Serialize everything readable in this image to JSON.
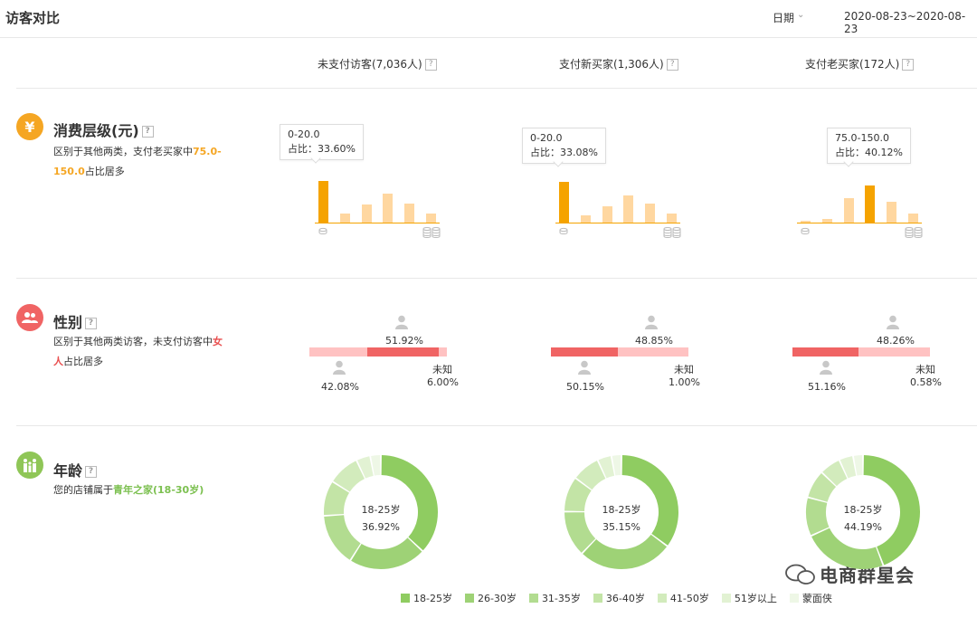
{
  "header": {
    "title": "访客对比",
    "date_label": "日期",
    "date_range": "2020-08-23~2020-08-23"
  },
  "columns": [
    {
      "label": "未支付访客(7,036人)"
    },
    {
      "label": "支付新买家(1,306人)"
    },
    {
      "label": "支付老买家(172人)"
    }
  ],
  "help_glyph": "?",
  "sections": {
    "consumption": {
      "title": "消费层级(元)",
      "desc_prefix": "区别于其他两类，支付老买家中",
      "desc_highlight": "75.0-150.0",
      "desc_suffix": "占比居多",
      "icon": "yen-icon",
      "icon_glyph": "¥",
      "color": "#f5a623"
    },
    "gender": {
      "title": "性别",
      "desc_prefix": "区别于其他两类访客，未支付访客中",
      "desc_highlight": "女人",
      "desc_suffix": "占比居多",
      "icon": "users-icon",
      "color": "#f06464"
    },
    "age": {
      "title": "年龄",
      "desc_prefix": "您的店铺属于",
      "desc_highlight": "青年之家(18-30岁)",
      "desc_suffix": "",
      "icon": "family-icon",
      "color": "#8fc657"
    }
  },
  "consumption_charts": [
    {
      "tooltip_range": "0-20.0",
      "tooltip_share": "占比：33.60%",
      "values": [
        33.6,
        7,
        14.5,
        23,
        15,
        7
      ],
      "highlight_index": 0
    },
    {
      "tooltip_range": "0-20.0",
      "tooltip_share": "占比：33.08%",
      "values": [
        33.08,
        6,
        13,
        22,
        15,
        7.5
      ],
      "highlight_index": 0
    },
    {
      "tooltip_range": "75.0-150.0",
      "tooltip_share": "占比：40.12%",
      "values": [
        1.5,
        3,
        19.5,
        30,
        16.5,
        7.5
      ],
      "highlight_index": 3
    }
  ],
  "gender_charts": [
    {
      "female": "51.92%",
      "male": "42.08%",
      "unknown_label": "未知",
      "unknown": "6.00%",
      "female_val": 51.92,
      "male_val": 42.08,
      "unknown_val": 6.0
    },
    {
      "female": "48.85%",
      "male": "50.15%",
      "unknown_label": "未知",
      "unknown": "1.00%",
      "female_val": 48.85,
      "male_val": 50.15,
      "unknown_val": 1.0
    },
    {
      "female": "48.26%",
      "male": "51.16%",
      "unknown_label": "未知",
      "unknown": "0.58%",
      "female_val": 48.26,
      "male_val": 51.16,
      "unknown_val": 0.58
    }
  ],
  "age_charts": [
    {
      "center_label": "18-25岁",
      "center_value": "36.92%",
      "values": [
        36.92,
        22,
        15,
        10,
        9,
        4,
        3
      ]
    },
    {
      "center_label": "18-25岁",
      "center_value": "35.15%",
      "values": [
        35.15,
        27,
        13,
        10,
        8,
        4,
        2.85
      ]
    },
    {
      "center_label": "18-25岁",
      "center_value": "44.19%",
      "values": [
        44.19,
        24,
        11,
        8,
        6,
        4,
        2.81
      ]
    }
  ],
  "age_legend": [
    {
      "label": "18-25岁",
      "color": "#8fcc61"
    },
    {
      "label": "26-30岁",
      "color": "#9ed276"
    },
    {
      "label": "31-35岁",
      "color": "#b2dc90"
    },
    {
      "label": "36-40岁",
      "color": "#c3e4a6"
    },
    {
      "label": "41-50岁",
      "color": "#d2ebbc"
    },
    {
      "label": "51岁以上",
      "color": "#e2f2d3"
    },
    {
      "label": "蒙面侠",
      "color": "#eef7e6"
    }
  ],
  "watermark": "电商群星会",
  "colors": {
    "female": "#f06464",
    "male": "#ffc2c2",
    "unknown": "#ffc2c2",
    "person": "#c8c8c8"
  }
}
